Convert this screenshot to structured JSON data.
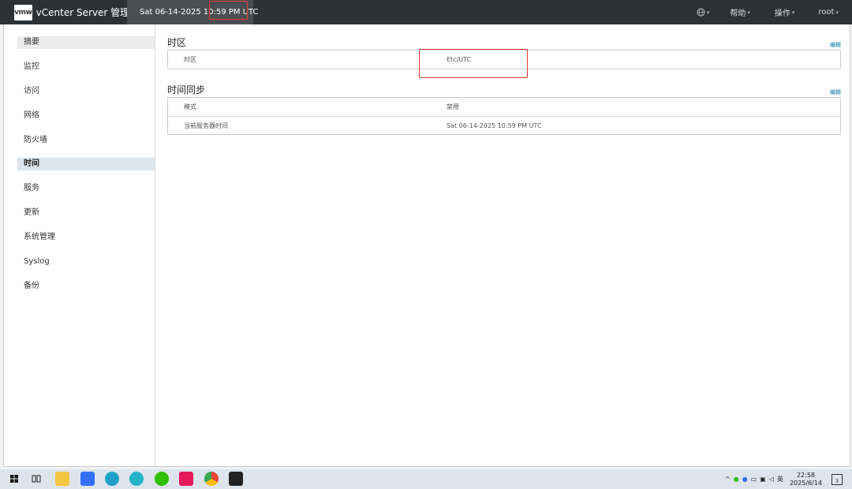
{
  "header": {
    "logo": "vmw",
    "title": "vCenter Server 管理",
    "datetime": "Sat 06-14-2025 10:59 PM UTC",
    "menu": {
      "help": "帮助",
      "actions": "操作",
      "user": "root"
    }
  },
  "sidebar": {
    "items": [
      {
        "label": "摘要"
      },
      {
        "label": "监控"
      },
      {
        "label": "访问"
      },
      {
        "label": "网络"
      },
      {
        "label": "防火墙"
      },
      {
        "label": "时间"
      },
      {
        "label": "服务"
      },
      {
        "label": "更新"
      },
      {
        "label": "系统管理"
      },
      {
        "label": "Syslog"
      },
      {
        "label": "备份"
      }
    ],
    "active": "时间"
  },
  "timezone": {
    "title": "时区",
    "edit": "编辑",
    "rows": [
      {
        "label": "时区",
        "value": "Etc/UTC"
      }
    ]
  },
  "timesync": {
    "title": "时间同步",
    "edit": "编辑",
    "rows": [
      {
        "label": "模式",
        "value": "禁用"
      },
      {
        "label": "当前服务器时间",
        "value": "Sat 06-14-2025 10:59 PM UTC"
      }
    ]
  },
  "taskbar": {
    "time": "22:58",
    "date": "2025/6/14",
    "ime": "英",
    "notifications": "3",
    "icons": [
      "start-icon",
      "task-view-icon",
      "file-explorer-icon",
      "feishu-icon",
      "edge-icon",
      "search-app-icon",
      "wechat-icon",
      "app-icon",
      "chrome-icon",
      "terminal-icon"
    ]
  },
  "colors": {
    "header_bg": "#2e3134",
    "active_nav": "#dce4ec",
    "link": "#0072a3",
    "annotation": "#e53935"
  }
}
